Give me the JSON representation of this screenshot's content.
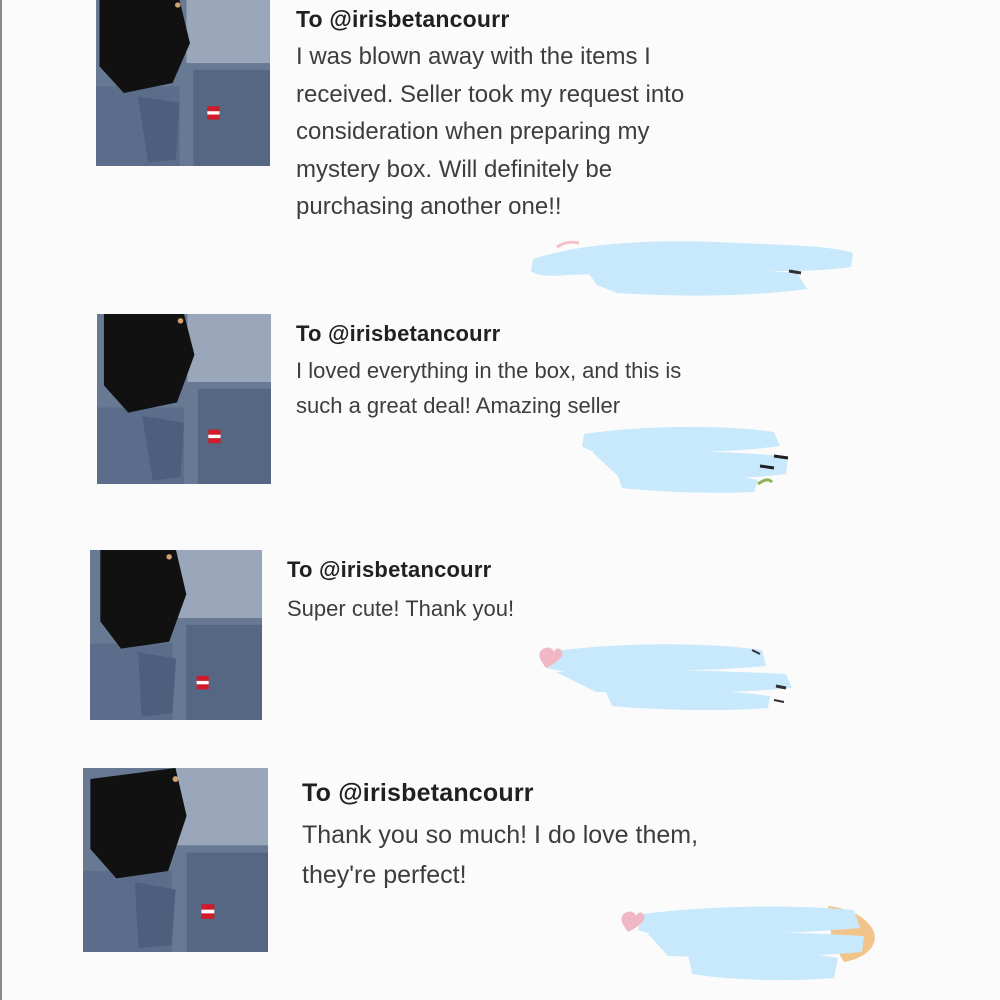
{
  "reviews": [
    {
      "recipient": "To @irisbetancourr",
      "message": "I was blown away with the items I\nreceived. Seller took my request into\nconsideration when preparing my\nmystery box. Will definitely be\npurchasing another one!!"
    },
    {
      "recipient": "To @irisbetancourr",
      "message": "I loved everything in the box, and this is\nsuch a great deal! Amazing seller"
    },
    {
      "recipient": "To @irisbetancourr",
      "message": "Super cute! Thank you!"
    },
    {
      "recipient": "To @irisbetancourr",
      "message": "Thank you so much! I do love them,\nthey're perfect!"
    }
  ],
  "colors": {
    "redaction": "#c8e9fb",
    "text": "#3d3d3d",
    "heading": "#202020",
    "background": "#fcfbfc"
  }
}
